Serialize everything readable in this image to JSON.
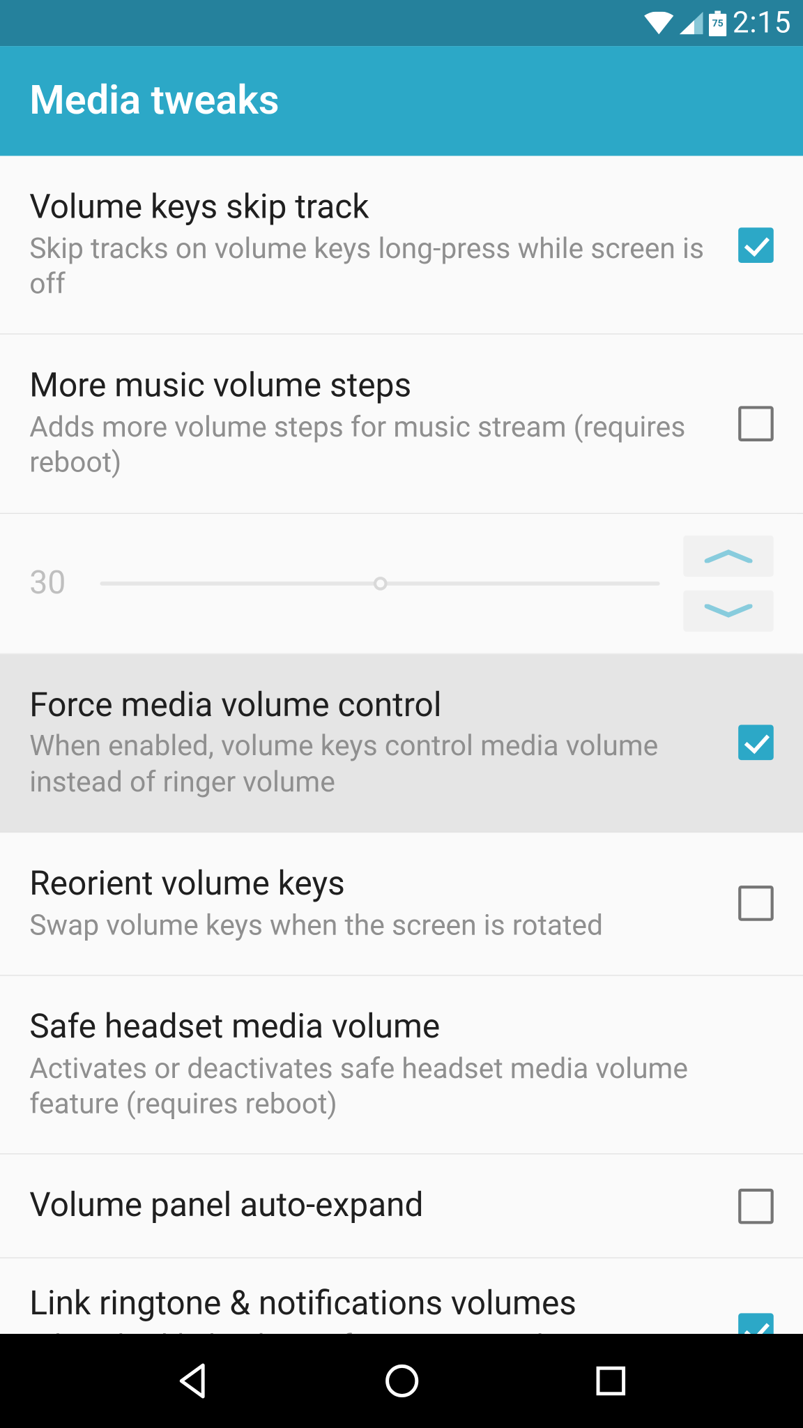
{
  "status": {
    "time": "2:15",
    "battery_level": "75"
  },
  "header": {
    "title": "Media tweaks"
  },
  "settings": [
    {
      "key": "volume-keys-skip-track",
      "title": "Volume keys skip track",
      "subtitle": "Skip tracks on volume keys long-press while screen is off",
      "checked": true
    },
    {
      "key": "more-music-volume-steps",
      "title": "More music volume steps",
      "subtitle": "Adds more volume steps for music stream (requires reboot)",
      "checked": false
    },
    {
      "key": "music-volume-steps-value",
      "type": "stepper",
      "value": "30",
      "disabled": true
    },
    {
      "key": "force-media-volume-control",
      "title": "Force media volume control",
      "subtitle": "When enabled, volume keys control media volume instead of ringer volume",
      "checked": true,
      "highlight": true
    },
    {
      "key": "reorient-volume-keys",
      "title": "Reorient volume keys",
      "subtitle": "Swap volume keys when the screen is rotated",
      "checked": false
    },
    {
      "key": "safe-headset-media-volume",
      "title": "Safe headset media volume",
      "subtitle": "Activates or deactivates safe headset media volume feature (requires reboot)",
      "checked": null
    },
    {
      "key": "volume-panel-auto-expand",
      "title": "Volume panel auto-expand",
      "subtitle": "",
      "checked": false
    },
    {
      "key": "link-ringtone-notifications-volumes",
      "title": "Link ringtone & notifications volumes",
      "subtitle": "When disabled, volumes for ringtone and",
      "checked": true,
      "clipped": true
    }
  ],
  "colors": {
    "accent": "#2ca8c7",
    "status_bar": "#25819c"
  }
}
